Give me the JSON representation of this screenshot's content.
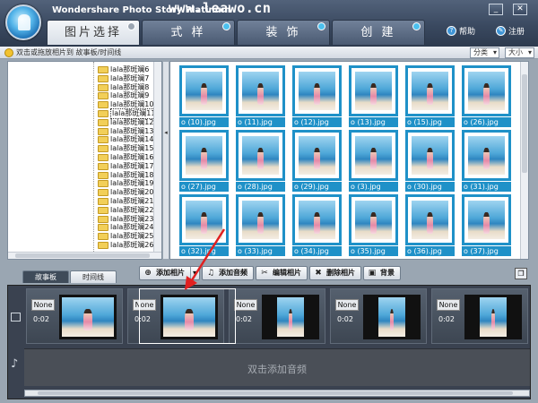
{
  "window": {
    "app_title": "Wondershare Photo Story Platinum",
    "site_url": "www.leawo.cn",
    "minimize_label": "_",
    "close_label": "✕"
  },
  "tabs": [
    {
      "label": "图片选择",
      "active": true
    },
    {
      "label": "式 样",
      "active": false
    },
    {
      "label": "装 饰",
      "active": false
    },
    {
      "label": "创 建",
      "active": false
    }
  ],
  "header": {
    "help_label": "帮助",
    "register_label": "注册"
  },
  "hintbar": {
    "hint_text": "双击或拖放相片到 故事板/时间线",
    "sort_label": "分类",
    "size_label": "大小"
  },
  "folder_tree": {
    "items": [
      {
        "label": "lala那斑斓6",
        "selected": false
      },
      {
        "label": "lala那斑斓7",
        "selected": false
      },
      {
        "label": "lala那斑斓8",
        "selected": false
      },
      {
        "label": "lala那斑斓9",
        "selected": false
      },
      {
        "label": "lala那斑斓10",
        "selected": false
      },
      {
        "label": "lala那斑斓11",
        "selected": true
      },
      {
        "label": "lala那斑斓12",
        "selected": false
      },
      {
        "label": "lala那斑斓13",
        "selected": false
      },
      {
        "label": "lala那斑斓14",
        "selected": false
      },
      {
        "label": "lala那斑斓15",
        "selected": false
      },
      {
        "label": "lala那斑斓16",
        "selected": false
      },
      {
        "label": "lala那斑斓17",
        "selected": false
      },
      {
        "label": "lala那斑斓18",
        "selected": false
      },
      {
        "label": "lala那斑斓19",
        "selected": false
      },
      {
        "label": "lala那斑斓20",
        "selected": false
      },
      {
        "label": "lala那斑斓21",
        "selected": false
      },
      {
        "label": "lala那斑斓22",
        "selected": false
      },
      {
        "label": "lala那斑斓23",
        "selected": false
      },
      {
        "label": "lala那斑斓24",
        "selected": false
      },
      {
        "label": "lala那斑斓25",
        "selected": false
      },
      {
        "label": "lala那斑斓26",
        "selected": false
      }
    ]
  },
  "thumbnails": [
    {
      "caption": "o (10).jpg"
    },
    {
      "caption": "o (11).jpg"
    },
    {
      "caption": "o (12).jpg"
    },
    {
      "caption": "o (13).jpg"
    },
    {
      "caption": "o (15).jpg"
    },
    {
      "caption": "o (26).jpg"
    },
    {
      "caption": "o (27).jpg"
    },
    {
      "caption": "o (28).jpg"
    },
    {
      "caption": "o (29).jpg"
    },
    {
      "caption": "o (3).jpg"
    },
    {
      "caption": "o (30).jpg"
    },
    {
      "caption": "o (31).jpg"
    },
    {
      "caption": "o (32).jpg"
    },
    {
      "caption": "o (33).jpg"
    },
    {
      "caption": "o (34).jpg"
    },
    {
      "caption": "o (35).jpg"
    },
    {
      "caption": "o (36).jpg"
    },
    {
      "caption": "o (37).jpg"
    }
  ],
  "view_tabs": [
    {
      "label": "故事板",
      "active": true
    },
    {
      "label": "时间线",
      "active": false
    }
  ],
  "toolbar": {
    "add_photo": "添加相片",
    "add_audio": "添加音频",
    "edit_photo": "编辑相片",
    "delete_photo": "删除相片",
    "background": "背景"
  },
  "storyboard": {
    "slides": [
      {
        "transition": "None",
        "duration": "0:02"
      },
      {
        "transition": "None",
        "duration": "0:02"
      },
      {
        "transition": "None",
        "duration": "0:02"
      },
      {
        "transition": "None",
        "duration": "0:02"
      },
      {
        "transition": "None",
        "duration": "0:02"
      }
    ],
    "audio_hint": "双击添加音频"
  },
  "colors": {
    "accent": "#1f91c8",
    "header_dark": "#3a4960",
    "storyboard_bg": "#3a4250",
    "annotation_red": "#e02020"
  },
  "icons": [
    "app-logo-icon",
    "hint-bulb-icon",
    "help-icon",
    "register-icon",
    "add-icon",
    "audio-icon",
    "edit-icon",
    "delete-icon",
    "background-icon",
    "film-icon",
    "music-note-icon",
    "restore-window-icon"
  ]
}
